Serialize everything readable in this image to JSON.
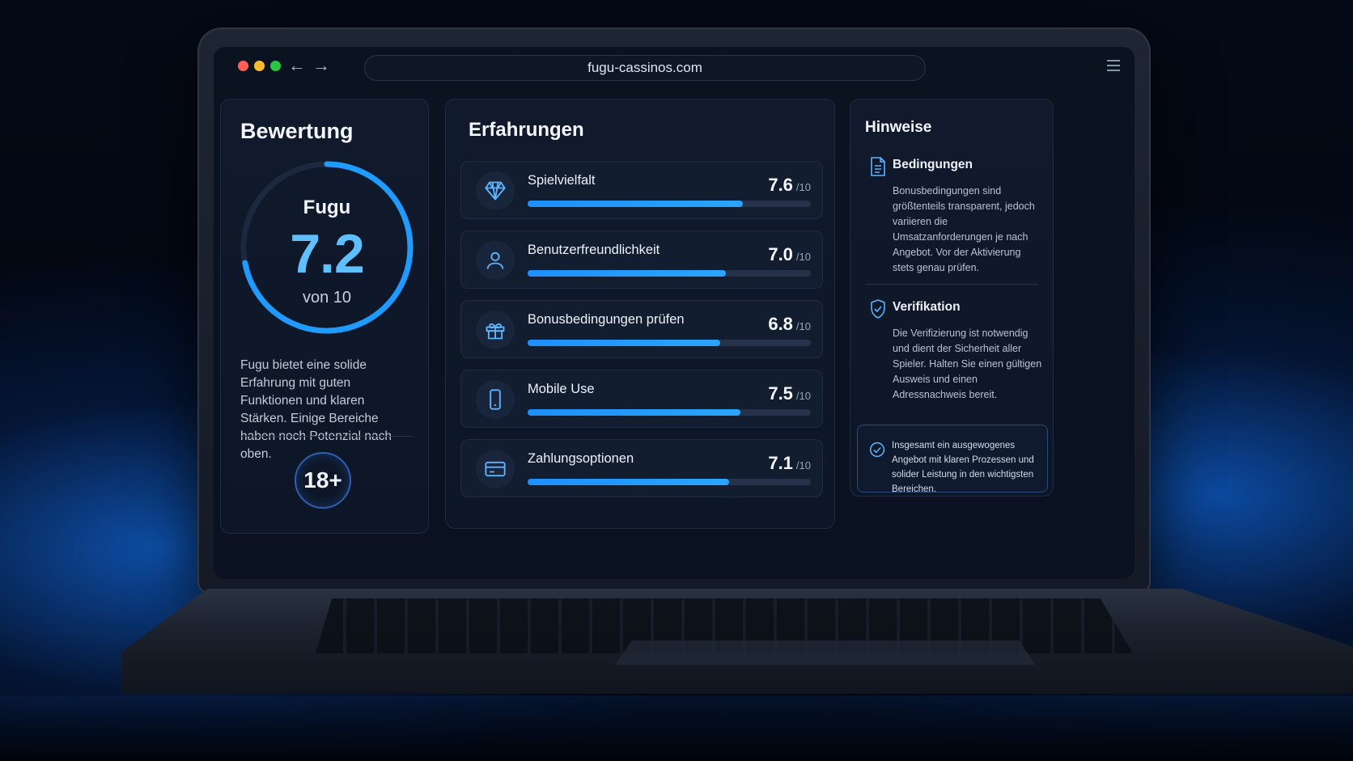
{
  "browser": {
    "url": "fugu-cassinos.com",
    "back_glyph": "←",
    "forward_glyph": "→"
  },
  "rating": {
    "title": "Bewertung",
    "brand": "Fugu",
    "score": "7.2",
    "score_value": 7.2,
    "score_max": 10,
    "out_of": "von 10",
    "description": "Fugu bietet eine solide Erfahrung mit guten Funktionen und klaren Stärken. Einige Bereiche haben noch Potenzial nach oben.",
    "age_badge": "18+",
    "accent_color": "#1f9bff"
  },
  "experiences": {
    "title": "Erfahrungen",
    "suffix": "/10",
    "items": [
      {
        "label": "Spielvielfalt",
        "score": "7.6",
        "value": 7.6,
        "icon": "diamond-icon"
      },
      {
        "label": "Benutzerfreundlichkeit",
        "score": "7.0",
        "value": 7.0,
        "icon": "user-icon"
      },
      {
        "label": "Bonusbedingungen prüfen",
        "score": "6.8",
        "value": 6.8,
        "icon": "gift-icon"
      },
      {
        "label": "Mobile Use",
        "score": "7.5",
        "value": 7.5,
        "icon": "smartphone-icon"
      },
      {
        "label": "Zahlungsoptionen",
        "score": "7.1",
        "value": 7.1,
        "icon": "credit-card-icon"
      }
    ]
  },
  "notes": {
    "title": "Hinweise",
    "conditions": {
      "title": "Bedingungen",
      "text": "Bonusbedingungen sind größtenteils transparent, jedoch variieren die Umsatzanforderungen je nach Angebot. Vor der Aktivierung stets genau prüfen.",
      "icon": "document-icon"
    },
    "verification": {
      "title": "Verifikation",
      "text": "Die Verifizierung ist notwendig und dient der Sicherheit aller Spieler. Halten Sie einen gültigen Ausweis und einen Adressnachweis bereit.",
      "icon": "shield-check-icon"
    },
    "summary": {
      "text": "Insgesamt ein ausgewogenes Angebot mit klaren Prozessen und solider Leistung in den wichtigsten Bereichen.",
      "icon": "check-circle-icon"
    }
  }
}
